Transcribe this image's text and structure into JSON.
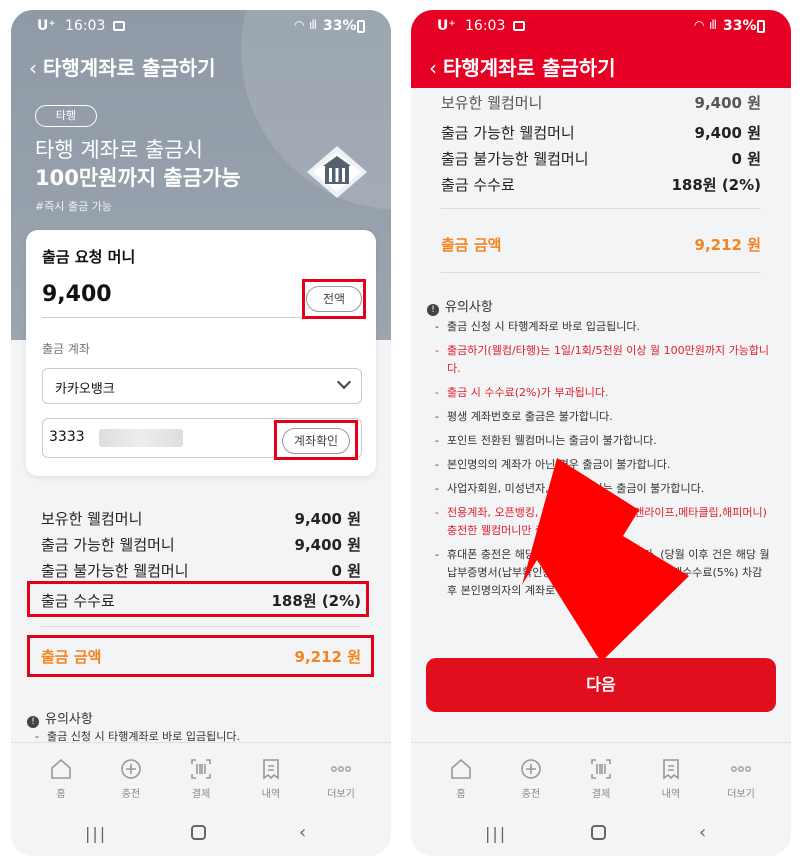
{
  "status": {
    "carrier": "U⁺",
    "time": "16:03",
    "battery": "33%"
  },
  "header": {
    "back_icon": "‹",
    "title": "타행계좌로 출금하기"
  },
  "promo": {
    "tag": "타행",
    "line1": "타행 계좌로 출금시",
    "line2": "100만원까지 출금가능",
    "hashtag": "#즉시 출금 가능"
  },
  "form": {
    "title": "출금 요청 머니",
    "amount": "9,400",
    "all_button": "전액",
    "account_label": "출금 계좌",
    "bank_selected": "카카오뱅크",
    "account_prefix": "3333",
    "verify_button": "계좌확인"
  },
  "summary": {
    "held_label": "보유한 웰컴머니",
    "held_value": "9,400 원",
    "available_label": "출금 가능한 웰컴머니",
    "available_value": "9,400 원",
    "unavailable_label": "출금 불가능한 웰컴머니",
    "unavailable_value": "0 원",
    "fee_label": "출금 수수료",
    "fee_value": "188원 (2%)",
    "total_label": "출금 금액",
    "total_value": "9,212 원"
  },
  "summary_right": {
    "held_label": "보유한 웰컴머니",
    "held_value": "9,400 원",
    "available_label": "출금 가능한 웰컴머니",
    "available_value": "9,400 원",
    "unavailable_label": "출금 불가능한 웰컴머니",
    "unavailable_value": "0 원",
    "fee_label": "출금 수수료",
    "fee_value": "188원 (2%)",
    "total_label": "출금 금액",
    "total_value": "9,212 원"
  },
  "notice": {
    "title": "유의사항",
    "left_first_item": "출금 신청 시 타행계좌로 바로 입금됩니다.",
    "items": [
      "출금 신청 시 타행계좌로 바로 입금됩니다.",
      "출금하기(웰컴/타행)는 1일/1회/5천원 이상 월 100만원까지 가능합니다.",
      "출금 시 수수료(2%)가 부과됩니다.",
      "평생 계좌번호로 출금은 불가합니다.",
      "포인트 전환된 웰컴머니는 출금이 불가합니다.",
      "본인명의의 계좌가 아닌 경우 출금이 불가합니다.",
      "사업자회원, 미성년자, 카카오미니는 출금이 불가합니다.",
      "전용계좌, 오픈뱅킹, 문화상품권, 전환(북앤라이프,메타클립,해피머니) 충전한 웰컴머니만 출금이 가능합니다.",
      "휴대폰 충전은 해당월에만 출금이 가능합니다. (당월 이후 건은 해당 월 납부증명서(납부확인증)를 고객센터로 제출 시 결제수수료(5%) 차감 후 본인명의자의 계좌로 환불 가능합니다)"
    ],
    "item7_red": "전용계좌, 오픈뱅킹, 문화상품권, 전환(북앤라이프,메타클립,해피머니) 충전한 웰컴머니만 출금이 가능합니다."
  },
  "next_button": "다음",
  "nav": [
    {
      "label": "홈",
      "icon": "home-icon"
    },
    {
      "label": "충전",
      "icon": "plus-circle-icon"
    },
    {
      "label": "결제",
      "icon": "barcode-icon"
    },
    {
      "label": "내역",
      "icon": "receipt-icon"
    },
    {
      "label": "더보기",
      "icon": "more-icon"
    }
  ],
  "colors": {
    "brand_red": "#e60023",
    "orange": "#f5831f",
    "notice_red": "#e0202c",
    "header_gray": "#8f9aa6"
  }
}
